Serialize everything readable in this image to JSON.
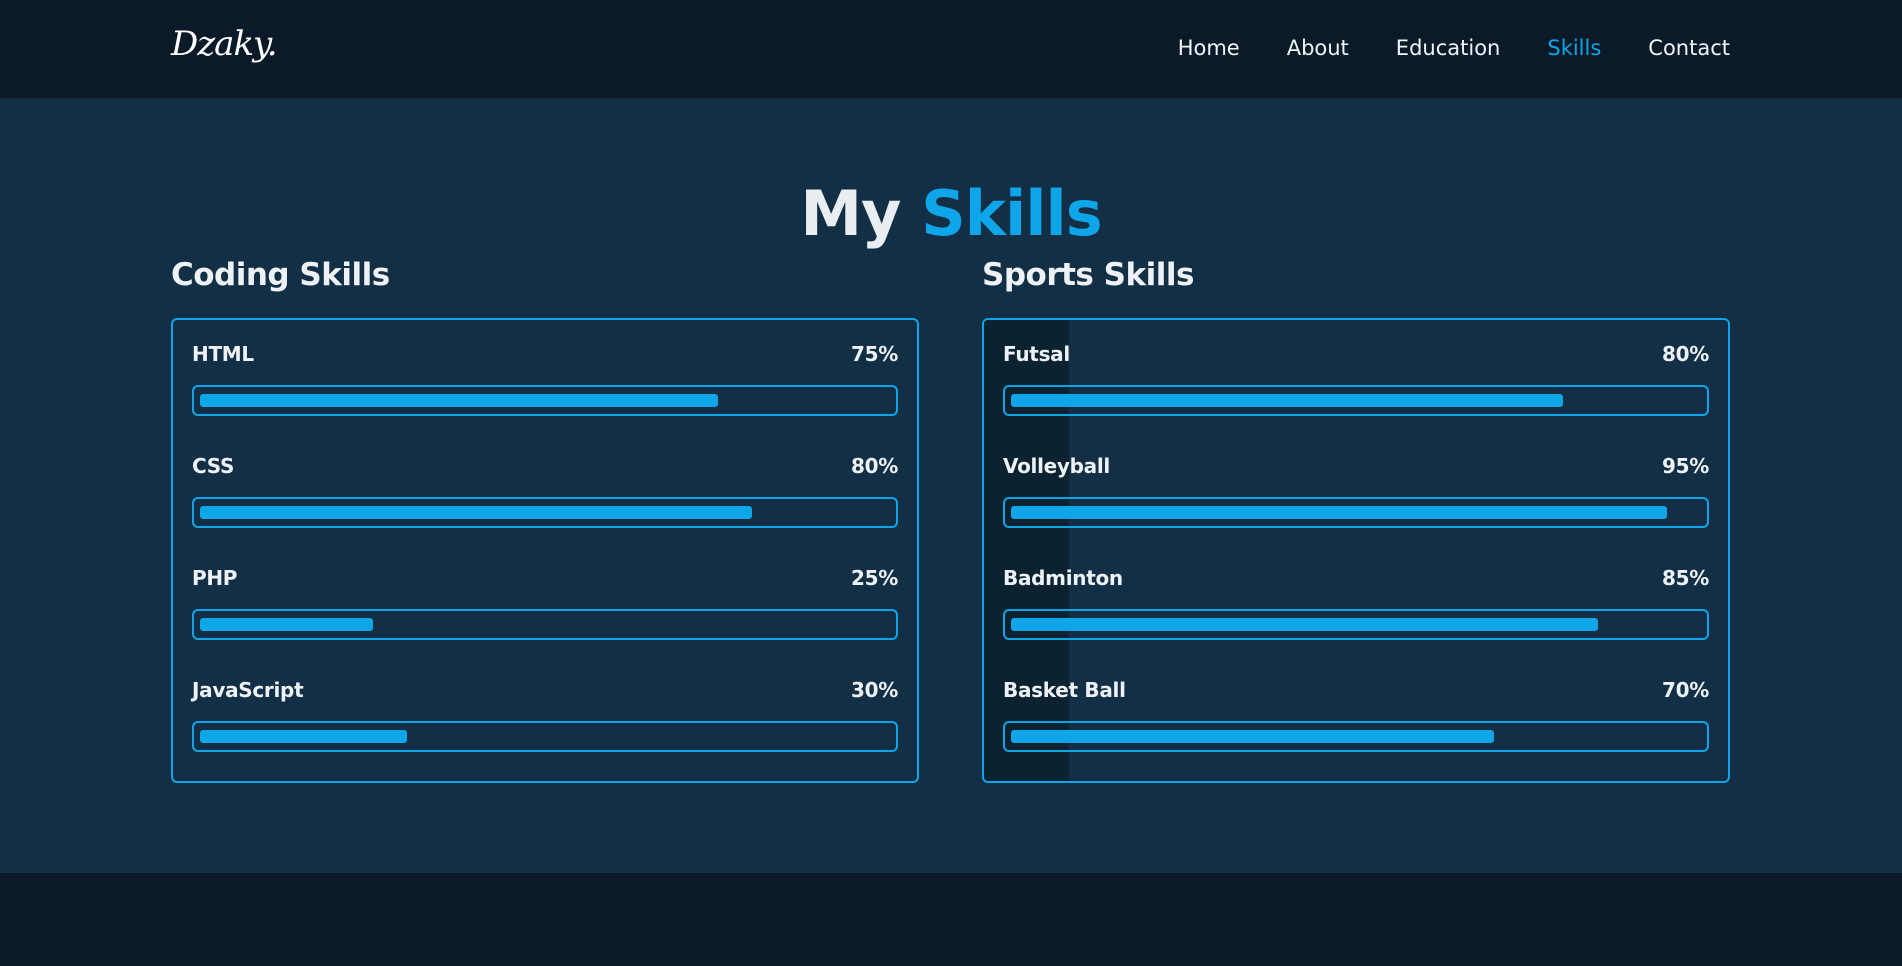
{
  "header": {
    "logo": "Dzaky.",
    "nav": [
      {
        "label": "Home",
        "active": false
      },
      {
        "label": "About",
        "active": false
      },
      {
        "label": "Education",
        "active": false
      },
      {
        "label": "Skills",
        "active": true
      },
      {
        "label": "Contact",
        "active": false
      }
    ]
  },
  "main": {
    "title_part1": "My",
    "title_part2": "Skills",
    "coding": {
      "title": "Coding Skills",
      "items": [
        {
          "name": "HTML",
          "percent_label": "75%",
          "value": 75
        },
        {
          "name": "CSS",
          "percent_label": "80%",
          "value": 80
        },
        {
          "name": "PHP",
          "percent_label": "25%",
          "value": 25
        },
        {
          "name": "JavaScript",
          "percent_label": "30%",
          "value": 30
        }
      ]
    },
    "sports": {
      "title": "Sports Skills",
      "items": [
        {
          "name": "Futsal",
          "percent_label": "80%",
          "value": 80
        },
        {
          "name": "Volleyball",
          "percent_label": "95%",
          "value": 95
        },
        {
          "name": "Badminton",
          "percent_label": "85%",
          "value": 85
        },
        {
          "name": "Basket Ball",
          "percent_label": "70%",
          "value": 70
        }
      ]
    }
  },
  "colors": {
    "accent": "#0ea5e9",
    "header_bg": "#0a1a28",
    "section_bg": "#122f45"
  }
}
